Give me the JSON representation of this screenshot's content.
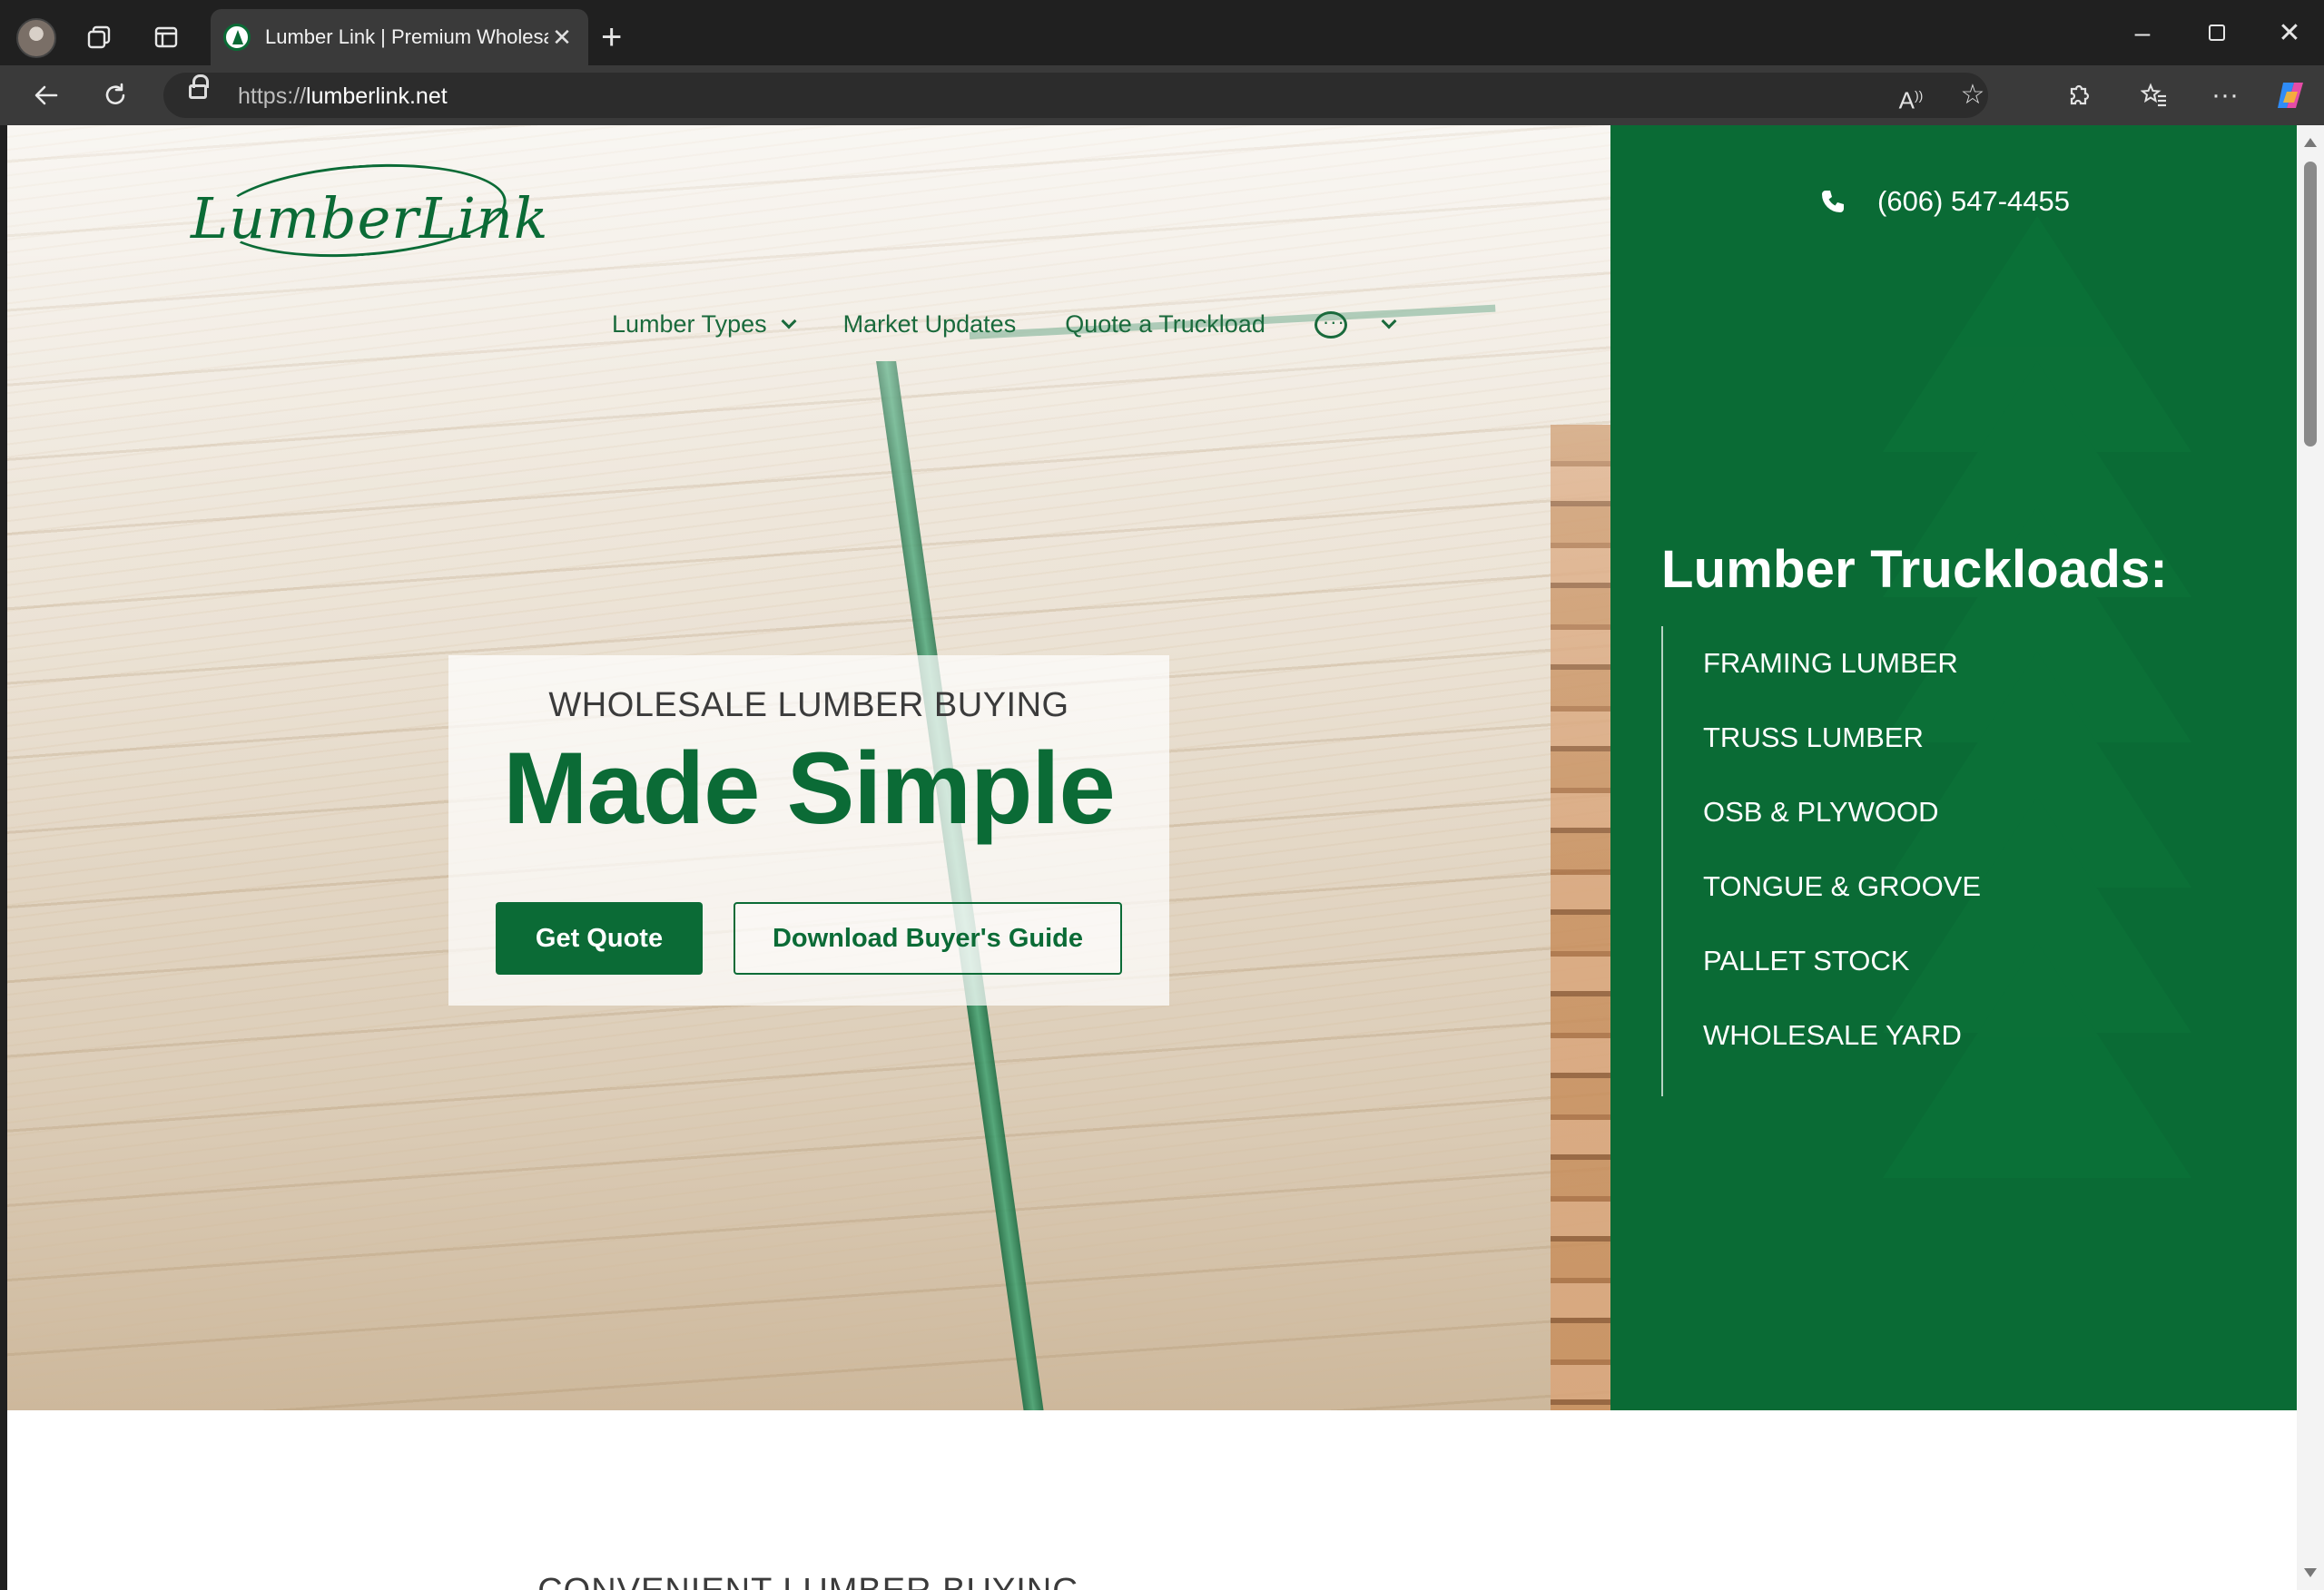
{
  "browser": {
    "tab_title": "Lumber Link | Premium Wholesale",
    "url_scheme": "https://",
    "url_host": "lumberlink.net"
  },
  "site": {
    "logo_text": "LumberLink",
    "nav": [
      {
        "label": "Lumber Types"
      },
      {
        "label": "Market Updates"
      },
      {
        "label": "Quote a Truckload"
      }
    ],
    "phone": "(606) 547-4455"
  },
  "hero": {
    "eyebrow": "WHOLESALE LUMBER BUYING",
    "headline": "Made Simple",
    "primary_button": "Get Quote",
    "secondary_button": "Download Buyer's Guide"
  },
  "sidebar": {
    "title": "Lumber Truckloads:",
    "items": [
      {
        "label": "FRAMING LUMBER"
      },
      {
        "label": "TRUSS LUMBER"
      },
      {
        "label": "OSB & PLYWOOD"
      },
      {
        "label": "TONGUE & GROOVE"
      },
      {
        "label": "PALLET STOCK"
      },
      {
        "label": "WHOLESALE YARD"
      }
    ]
  },
  "next_section": {
    "eyebrow": "CONVENIENT LUMBER BUYING"
  },
  "colors": {
    "brand_green": "#0a6b35",
    "chrome_dark": "#202020",
    "chrome_toolbar": "#3a3a3a"
  }
}
